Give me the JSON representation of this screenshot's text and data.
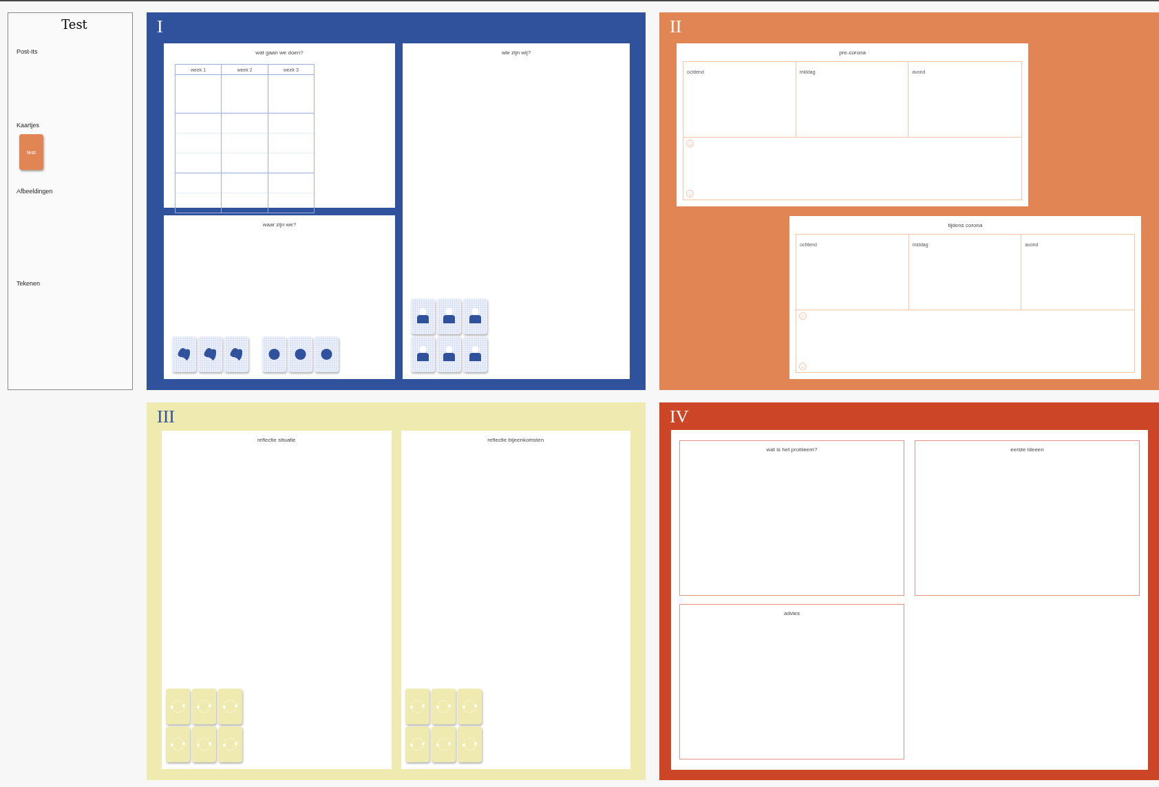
{
  "sidebar": {
    "title": "Test",
    "sections": [
      {
        "label": "Post-Its"
      },
      {
        "label": "Kaartjes",
        "cards": [
          {
            "label": "test"
          }
        ]
      },
      {
        "label": "Afbeeldingen"
      },
      {
        "label": "Tekenen"
      }
    ]
  },
  "quadrant_1": {
    "numeral": "I",
    "plan": {
      "title": "wat gaan we doen?",
      "columns": [
        "week 1",
        "week 2",
        "week 3"
      ]
    },
    "place": {
      "title": "waar zijn we?"
    },
    "team": {
      "title": "wie zijn wij?"
    }
  },
  "quadrant_2": {
    "numeral": "II",
    "panels": [
      {
        "title": "pre-corona",
        "columns": [
          "ochtend",
          "middag",
          "avond"
        ]
      },
      {
        "title": "tijdens corona",
        "columns": [
          "ochtend",
          "middag",
          "avond"
        ]
      }
    ]
  },
  "quadrant_3": {
    "numeral": "III",
    "panels": [
      {
        "title": "reflectie situatie"
      },
      {
        "title": "reflectie bijeenkomsten"
      }
    ]
  },
  "quadrant_4": {
    "numeral": "IV",
    "boxes": [
      {
        "title": "wat is het probleem?"
      },
      {
        "title": "eerste ideeen"
      },
      {
        "title": "advies"
      }
    ]
  }
}
